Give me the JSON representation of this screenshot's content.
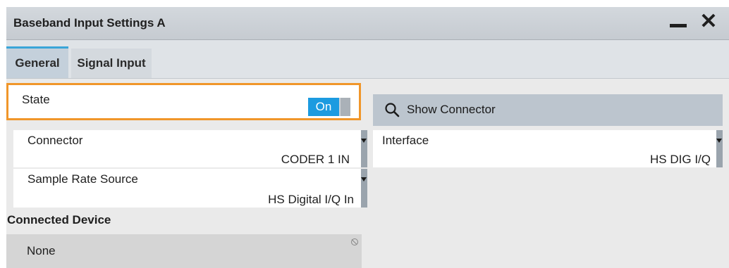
{
  "window": {
    "title": "Baseband Input Settings  A",
    "minimize_label": "",
    "close_label": "✕"
  },
  "tabs": [
    {
      "label": "General",
      "active": true
    },
    {
      "label": "Signal Input",
      "active": false
    }
  ],
  "state": {
    "label": "State",
    "toggle_value": "On"
  },
  "show_connector": {
    "label": "Show Connector",
    "icon": "search-icon"
  },
  "connector": {
    "label": "Connector",
    "value": "CODER 1 IN"
  },
  "interface": {
    "label": "Interface",
    "value": "HS DIG I/Q"
  },
  "sample_rate_source": {
    "label": "Sample Rate Source",
    "value": "HS Digital I/Q In"
  },
  "connected_device": {
    "section_label": "Connected Device",
    "value": "None",
    "icon": "read-only-icon"
  },
  "colors": {
    "accent": "#1c9be0",
    "focus_border": "#f0962a",
    "tab_indicator": "#3aa5d8"
  }
}
